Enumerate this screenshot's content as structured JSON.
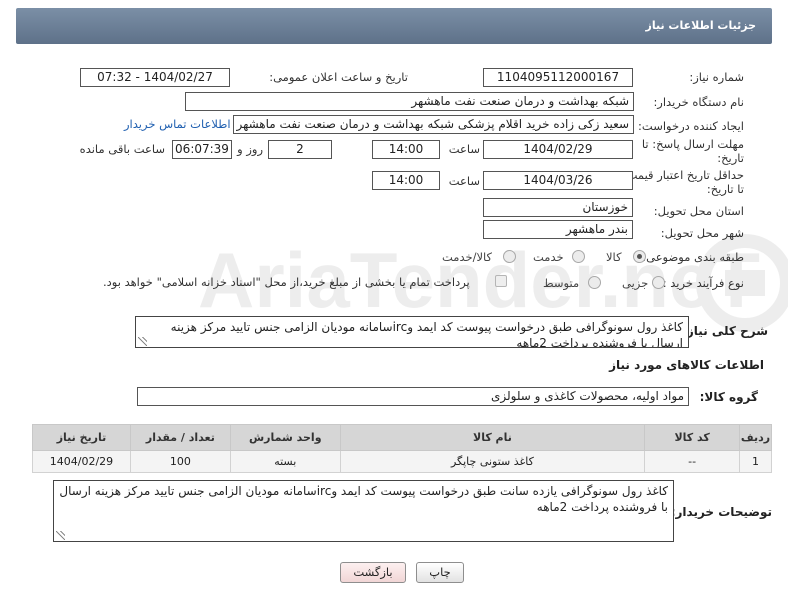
{
  "header": {
    "title": "جزئیات اطلاعات نیاز"
  },
  "labels": {
    "need_number": "شماره نیاز:",
    "announce_datetime": "تاریخ و ساعت اعلان عمومی:",
    "buyer_org": "نام دستگاه خریدار:",
    "requester": "ایجاد کننده درخواست:",
    "deadline": "مهلت ارسال پاسخ: تا تاریخ:",
    "price_validity": "حداقل تاریخ اعتبار قیمت: تا تاریخ:",
    "hour": "ساعت",
    "day_and": "روز و",
    "remaining": "ساعت باقی مانده",
    "province": "استان محل تحویل:",
    "city": "شهر محل تحویل:",
    "category": "طبقه بندی موضوعی:",
    "process_type": "نوع فرآیند خرید :",
    "description": "شرح کلی نیاز:",
    "goods_info": "اطلاعات کالاهای مورد نیاز",
    "goods_group": "گروه کالا:",
    "buyer_notes": "توضیحات خریدار:"
  },
  "fields": {
    "need_number": "1104095112000167",
    "announce_datetime": "1404/02/27 - 07:32",
    "buyer_org": "شبکه بهداشت و درمان صنعت نفت ماهشهر",
    "requester": "سعید زکی زاده خرید اقلام پزشکی شبکه بهداشت و درمان صنعت نفت ماهشهر",
    "contact_link": "اطلاعات تماس خریدار",
    "deadline_date": "1404/02/29",
    "deadline_time": "14:00",
    "remaining_days": "2",
    "remaining_time": "06:07:39",
    "validity_date": "1404/03/26",
    "validity_time": "14:00",
    "province": "خوزستان",
    "city": "بندر ماهشهر",
    "description": "کاغذ رول سونوگرافی  طبق درخواست پیوست کد ایمد وircسامانه مودیان الزامی جنس تایید مرکز هزینه ارسال با فروشنده پرداخت 2ماهه",
    "goods_group": "مواد اولیه، محصولات کاغذی و سلولزی",
    "buyer_notes": "کاغذ رول سونوگرافی یازده سانت طبق درخواست پیوست کد ایمد وircسامانه مودیان الزامی جنس تایید مرکز هزینه ارسال با فروشنده پرداخت 2ماهه"
  },
  "category_options": [
    {
      "label": "کالا",
      "selected": true
    },
    {
      "label": "خدمت",
      "selected": false
    },
    {
      "label": "کالا/خدمت",
      "selected": false
    }
  ],
  "process_options": [
    {
      "label": "جزیی",
      "selected": false
    },
    {
      "label": "متوسط",
      "selected": false
    }
  ],
  "payment_note": "پرداخت تمام یا بخشی از مبلغ خرید،از محل \"اسناد خزانه اسلامی\" خواهد بود.",
  "table": {
    "headers": [
      "ردیف",
      "کد کالا",
      "نام کالا",
      "واحد شمارش",
      "تعداد / مقدار",
      "تاریخ نیاز"
    ],
    "rows": [
      [
        "1",
        "--",
        "کاغذ ستونی چاپگر",
        "بسته",
        "100",
        "1404/02/29"
      ]
    ]
  },
  "buttons": {
    "print": "چاپ",
    "back": "بازگشت"
  },
  "watermark_text": "AriaTender.neT",
  "colors": {
    "header": "#6a7d94",
    "link": "#1f5fb0",
    "back_button_bg": "#f7e3e3"
  }
}
